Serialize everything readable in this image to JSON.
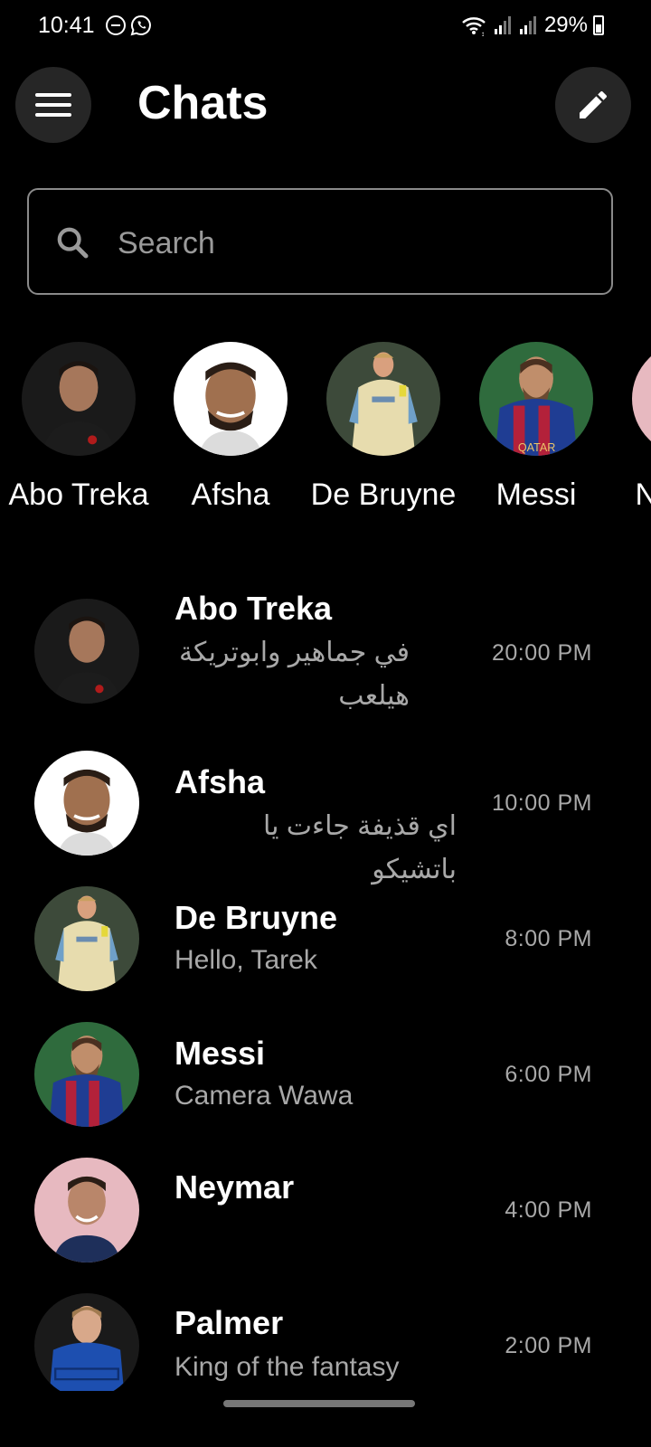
{
  "status_bar": {
    "time": "10:41",
    "battery": "29%",
    "left_icons": [
      "dnd-icon",
      "whatsapp-icon"
    ],
    "right_icons": [
      "wifi-icon",
      "signal-icon",
      "signal-icon"
    ]
  },
  "header": {
    "title": "Chats",
    "menu_icon": "hamburger-menu-icon",
    "edit_icon": "pencil-icon"
  },
  "search": {
    "placeholder": "Search",
    "value": ""
  },
  "stories": [
    {
      "name": "Abo Treka"
    },
    {
      "name": "Afsha"
    },
    {
      "name": "De Bruyne"
    },
    {
      "name": "Messi"
    },
    {
      "name": "Neymar"
    }
  ],
  "chats": [
    {
      "name": "Abo Treka",
      "message": "في جماهير وابوتريكة هيلعب",
      "time": "20:00 PM"
    },
    {
      "name": "Afsha",
      "message": "اي قذيفة جاءت يا باتشيكو",
      "time": "10:00 PM"
    },
    {
      "name": "De Bruyne",
      "message": "Hello, Tarek",
      "time": "8:00 PM"
    },
    {
      "name": "Messi",
      "message": "Camera Wawa",
      "time": "6:00 PM"
    },
    {
      "name": "Neymar",
      "message": "",
      "time": "4:00 PM"
    },
    {
      "name": "Palmer",
      "message": "King of the fantasy",
      "time": "2:00 PM"
    }
  ],
  "colors": {
    "background": "#000000",
    "button_bg": "#262626",
    "secondary_text": "#a8a8a8",
    "search_border": "#8a8a8a"
  }
}
